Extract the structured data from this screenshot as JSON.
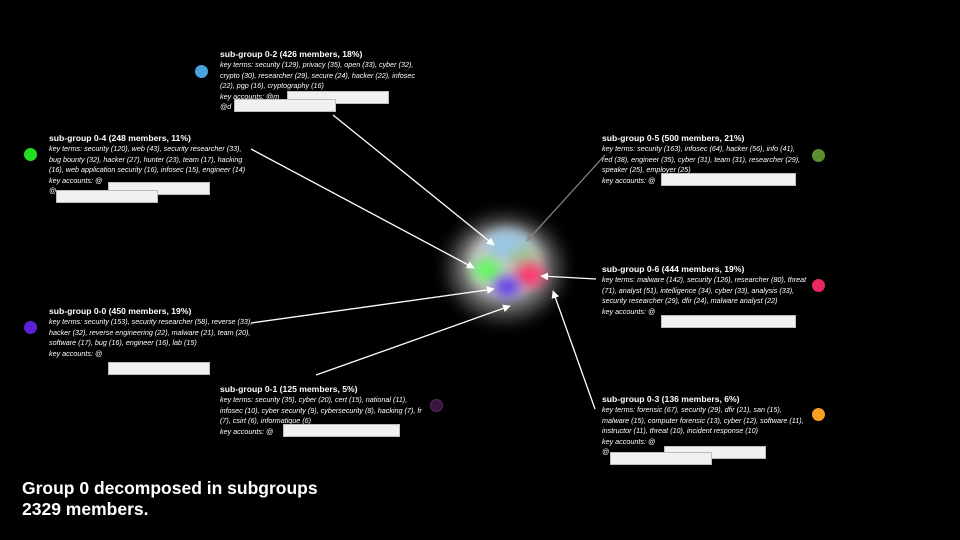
{
  "title_line1": "Group 0 decomposed in subgroups",
  "title_line2": "2329 members.",
  "subgroups": {
    "sg02": {
      "title": "sub-group 0-2 (426 members, 18%)",
      "terms": "key terms: security (129), privacy (35), open (33), cyber (32), crypto (30), researcher (29), secure (24), hacker (22), infosec (22), pgp (16), cryptography (16)",
      "accounts": "key accounts: @m",
      "accounts2": "@d",
      "color": "#4aa3df"
    },
    "sg04": {
      "title": "sub-group 0-4 (248 members, 11%)",
      "terms": "key terms: security (120), web (43), security researcher (33), bug bounty (32), hacker (27), hunter (23), team (17), hacking (16), web application security (16), infosec (15), engineer (14)",
      "accounts": "key accounts: @",
      "accounts2": "@",
      "color": "#22dd22"
    },
    "sg05": {
      "title": "sub-group 0-5 (500 members, 21%)",
      "terms": "key terms: security (163), infosec (64), hacker (56), info (41), red (38), engineer (35), cyber (31), team (31), researcher (29), speaker (25), employer (25)",
      "accounts": "key accounts: @",
      "color": "#5a8f2f"
    },
    "sg06": {
      "title": "sub-group 0-6 (444 members, 19%)",
      "terms": "key terms: malware (142), security (126), researcher (80), threat (71), analyst (51), intelligence (34), cyber (33), analysis (33), security researcher (29), dfir (24), malware analyst (22)",
      "accounts": "key accounts: @",
      "color": "#e8285f"
    },
    "sg00": {
      "title": "sub-group 0-0 (450 members, 19%)",
      "terms": "key terms: security (153), security researcher (58), reverse (33), hacker (32), reverse engineering (22), malware (21), team (20), software (17), bug (16), engineer (16), lab (15)",
      "accounts": "key accounts: @",
      "color": "#5a22d6"
    },
    "sg01": {
      "title": "sub-group 0-1 (125 members, 5%)",
      "terms": "key terms: security (35), cyber (20), cert (15), national (11), infosec (10), cyber security (9), cybersecurity (8), hacking (7), fr (7), csirt (6), informatique (6)",
      "accounts": "key accounts: @",
      "color": "#3a1540"
    },
    "sg03": {
      "title": "sub-group 0-3 (136 members, 6%)",
      "terms": "key terms: forensic (67), security (29), dfir (21), san (15), malware (15), computer forensic (13), cyber (12), software (11), instructor (11), threat (10), incident response (10)",
      "accounts": "key accounts: @",
      "accounts2": "@",
      "color": "#f5a020"
    }
  }
}
